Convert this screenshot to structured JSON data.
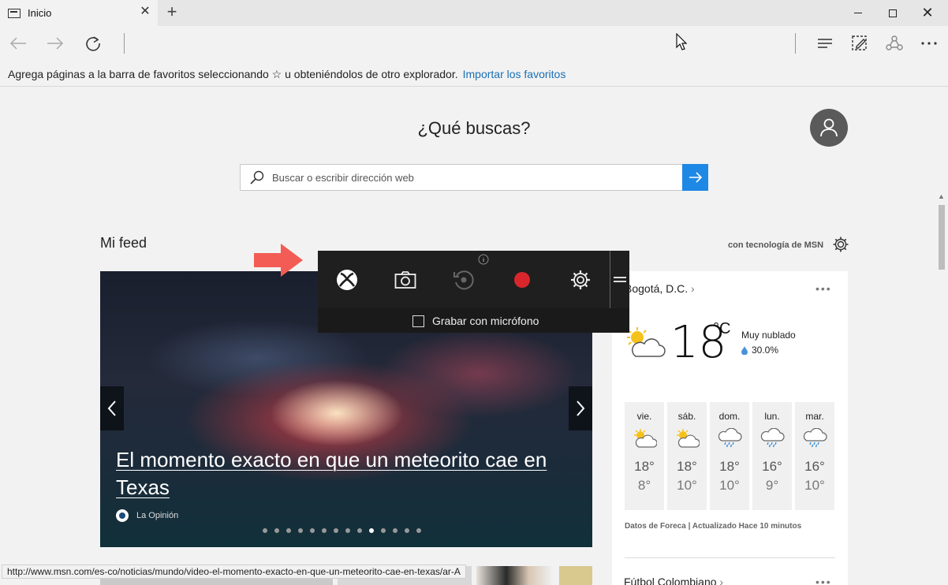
{
  "tab": {
    "title": "Inicio",
    "close": "✕",
    "new_tab": "+"
  },
  "window": {
    "close": "✕"
  },
  "favorites_bar": {
    "message": "Agrega páginas a la barra de favoritos seleccionando ☆ u obteniéndolos de otro explorador.",
    "link": "Importar los favoritos"
  },
  "search": {
    "heading": "¿Qué buscas?",
    "placeholder": "Buscar o escribir dirección web"
  },
  "feed": {
    "title": "Mi feed",
    "credit": "con tecnología de MSN"
  },
  "hero": {
    "title": "El momento exacto en que un meteorito cae en Texas",
    "source": "La Opinión",
    "dot_count": 14,
    "active_dot": 9
  },
  "weather": {
    "location": "Bogotá, D.C.",
    "more": "•••",
    "temperature": "18",
    "unit": "°C",
    "condition": "Muy nublado",
    "rain_chance": "30.0%",
    "forecast": [
      {
        "day": "vie.",
        "high": "18°",
        "low": "8°",
        "icon": "partly-cloudy-icon"
      },
      {
        "day": "sáb.",
        "high": "18°",
        "low": "10°",
        "icon": "partly-cloudy-icon"
      },
      {
        "day": "dom.",
        "high": "18°",
        "low": "10°",
        "icon": "rain-icon"
      },
      {
        "day": "lun.",
        "high": "16°",
        "low": "9°",
        "icon": "rain-icon"
      },
      {
        "day": "mar.",
        "high": "16°",
        "low": "10°",
        "icon": "rain-icon"
      }
    ],
    "footer": "Datos de Foreca | Actualizado Hace 10 minutos"
  },
  "sports": {
    "title": "Fútbol Colombiano",
    "more": "•••"
  },
  "game_bar": {
    "mic_label": "Grabar con micrófono",
    "mic_checked": false
  },
  "status_bar": {
    "url": "http://www.msn.com/es-co/noticias/mundo/video-el-momento-exacto-en-que-un-meteorito-cae-en-texas/ar-A"
  },
  "colors": {
    "accent": "#1e88e5",
    "link": "#1a6fb3",
    "record": "#d9262c",
    "annotation_arrow": "#f25c54"
  }
}
